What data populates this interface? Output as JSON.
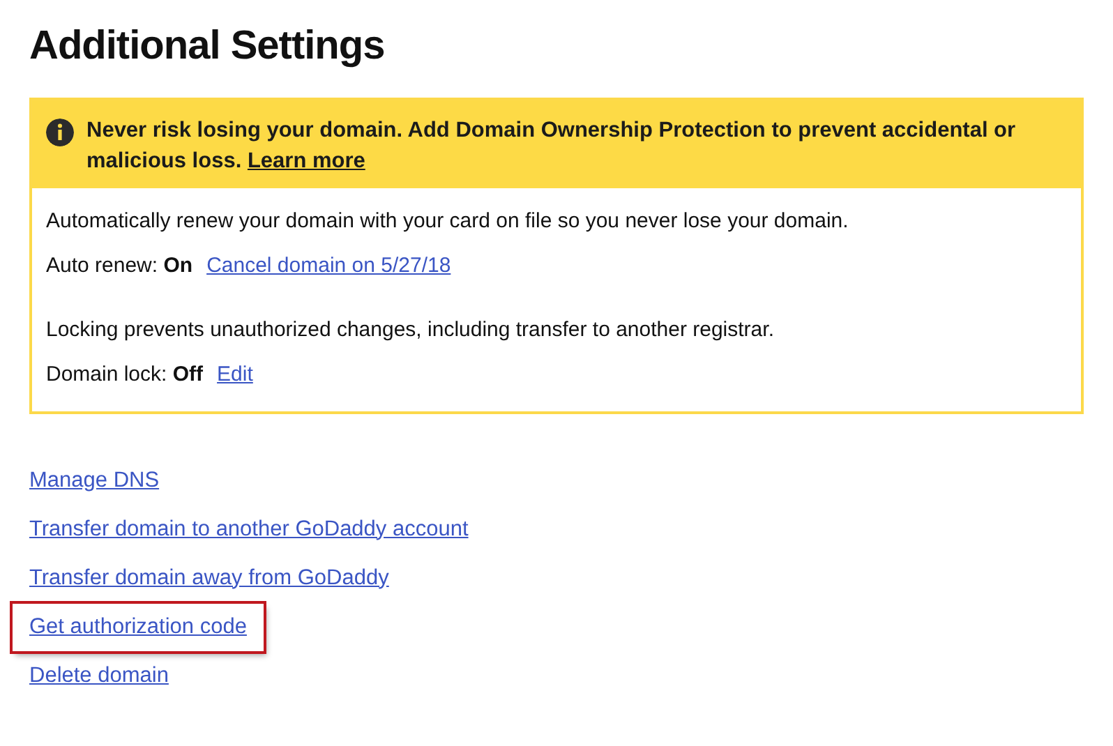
{
  "title": "Additional Settings",
  "notice": {
    "message": "Never risk losing your domain. Add Domain Ownership Protection to prevent accidental or malicious loss.",
    "link": "Learn more"
  },
  "settings": [
    {
      "description": "Automatically renew your domain with your card on file so you never lose your domain.",
      "status": "Auto renew: **On**",
      "action": "Cancel domain on 5/27/18"
    },
    {
      "description": "Locking prevents unauthorized changes, including transfer to another registrar.",
      "status": "Domain lock: **Off**",
      "action": "Edit"
    }
  ],
  "links": [
    {
      "label": "Manage DNS",
      "highlighted": false
    },
    {
      "label": "Transfer domain to another GoDaddy account",
      "highlighted": false
    },
    {
      "label": "Transfer domain away from GoDaddy",
      "highlighted": false
    },
    {
      "label": "Get authorization code",
      "highlighted": true
    },
    {
      "label": "Delete domain",
      "highlighted": false
    }
  ]
}
